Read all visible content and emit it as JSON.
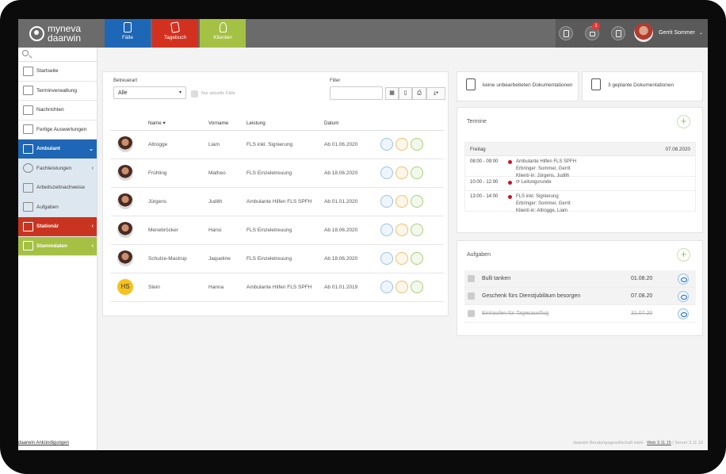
{
  "app": {
    "logo_line1": "myneva",
    "logo_line2": "daarwin"
  },
  "nav_tabs": [
    {
      "label": "Fälle",
      "color": "#1e67b6"
    },
    {
      "label": "Tagebuch",
      "color": "#d3311f"
    },
    {
      "label": "Klienten",
      "color": "#a5c144"
    }
  ],
  "topbar": {
    "notification_count": "1",
    "user_name": "Gerrit Sommer"
  },
  "sidebar": {
    "items": [
      {
        "label": "Startseite",
        "icon": "calendar-grid-icon"
      },
      {
        "label": "Terminverwaltung",
        "icon": "calendar-icon"
      },
      {
        "label": "Nachrichten",
        "icon": "envelope-icon"
      },
      {
        "label": "Fertige Auswertungen",
        "icon": "report-icon"
      },
      {
        "label": "Ambulant",
        "icon": "clipboard-icon"
      },
      {
        "label": "Fachleistungen",
        "icon": "clock-icon"
      },
      {
        "label": "Arbeitszeitnachweise",
        "icon": "document-icon"
      },
      {
        "label": "Aufgaben",
        "icon": "checklist-icon"
      },
      {
        "label": "Stationär",
        "icon": "clipboard-icon"
      },
      {
        "label": "Stammdaten",
        "icon": "database-icon"
      }
    ]
  },
  "filters": {
    "betreuerart_label": "Betreuerart",
    "betreuerart_value": "Alle",
    "nur_aktuelle_label": "Nur aktuelle Fälle",
    "filter_label": "Filter"
  },
  "table": {
    "headers": [
      "Name ▾",
      "Vorname",
      "Leistung",
      "Datum"
    ],
    "rows": [
      {
        "name": "Altrogge",
        "vorname": "Liam",
        "leistung": "FLS inkl. Signierung",
        "datum": "Ab 01.06.2020",
        "initials": ""
      },
      {
        "name": "Frühling",
        "vorname": "Matheo",
        "leistung": "FLS Einzeletreuung",
        "datum": "Ab 18.06.2020",
        "initials": ""
      },
      {
        "name": "Jürgens",
        "vorname": "Judith",
        "leistung": "Ambulante Hilfen FLS SPFH",
        "datum": "Ab 01.01.2020",
        "initials": ""
      },
      {
        "name": "Menebröcker",
        "vorname": "Hansi",
        "leistung": "FLS Einzeletreuung",
        "datum": "Ab 18.06.2020",
        "initials": ""
      },
      {
        "name": "Schulze-Mastrup",
        "vorname": "Jaqueline",
        "leistung": "FLS Einzeletreuung",
        "datum": "Ab 18.06.2020",
        "initials": ""
      },
      {
        "name": "Stein",
        "vorname": "Hanna",
        "leistung": "Ambulante Hilfen FLS SPFH",
        "datum": "Ab 01.01.2019",
        "initials": "HS"
      }
    ]
  },
  "docs": {
    "unprocessed": "keine unbearbeiteten Dokumentationen",
    "planned": "3 geplante Dokumentationen"
  },
  "termine": {
    "title": "Termine",
    "day": "Freitag",
    "date": "07.08.2020",
    "appointments": [
      {
        "time": "08:00 - 09:00",
        "line1": "Ambulante Hilfen FLS SPFH",
        "line2": "Erbringer: Sommer, Gerrit",
        "line3": "Klient/-in: Jürgens, Judith"
      },
      {
        "time": "10:00 - 12:00",
        "line1": "⟳ Leitungsrunde",
        "line2": "",
        "line3": ""
      },
      {
        "time": "13:00 - 14:00",
        "line1": "FLS inkl. Signierung",
        "line2": "Erbringer: Sommer, Gerrit",
        "line3": "Klient/-in: Altrogge, Liam"
      }
    ]
  },
  "aufgaben": {
    "title": "Aufgaben",
    "tasks": [
      {
        "label": "Bulli tanken",
        "date": "01.08.20",
        "done": false
      },
      {
        "label": "Geschenk fürs Dienstjubiläum besorgen",
        "date": "07.08.20",
        "done": false
      },
      {
        "label": "Einkaufen für Tagesausflug",
        "date": "31.07.20",
        "done": true
      }
    ]
  },
  "footer": {
    "link": "daarwin Ankündigungen",
    "company": "daarwin Beratungsgesellschaft mbH · ",
    "version": "Web 3.11.15",
    "server": " | Server 3.11.16"
  }
}
